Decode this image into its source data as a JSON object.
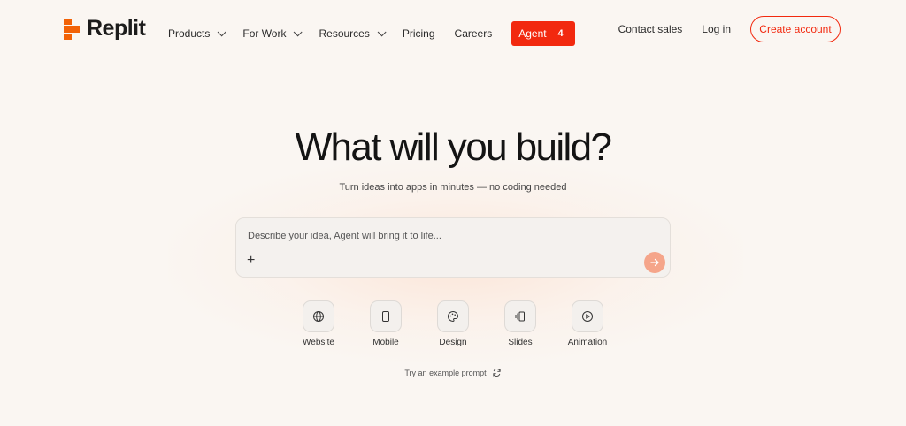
{
  "brand": {
    "name": "Replit",
    "accent": "#f2290f",
    "logo_color": "#f26207"
  },
  "nav": {
    "items": [
      {
        "label": "Products",
        "dropdown": true
      },
      {
        "label": "For Work",
        "dropdown": true
      },
      {
        "label": "Resources",
        "dropdown": true
      },
      {
        "label": "Pricing",
        "dropdown": false
      },
      {
        "label": "Careers",
        "dropdown": false
      }
    ],
    "agent": {
      "label": "Agent",
      "badge": "4"
    },
    "contact_sales": "Contact sales",
    "log_in": "Log in",
    "create_account": "Create account"
  },
  "hero": {
    "title": "What will you build?",
    "subtitle": "Turn ideas into apps in minutes — no coding needed"
  },
  "prompt": {
    "placeholder": "Describe your idea, Agent will bring it to life...",
    "value": "",
    "add_icon": "plus-icon",
    "send_icon": "arrow-right-icon"
  },
  "app_types": [
    {
      "label": "Website",
      "icon": "globe-icon"
    },
    {
      "label": "Mobile",
      "icon": "phone-icon"
    },
    {
      "label": "Design",
      "icon": "palette-icon"
    },
    {
      "label": "Slides",
      "icon": "slides-icon"
    },
    {
      "label": "Animation",
      "icon": "play-icon"
    }
  ],
  "example_prompt": {
    "label": "Try an example prompt",
    "icon": "refresh-icon"
  }
}
